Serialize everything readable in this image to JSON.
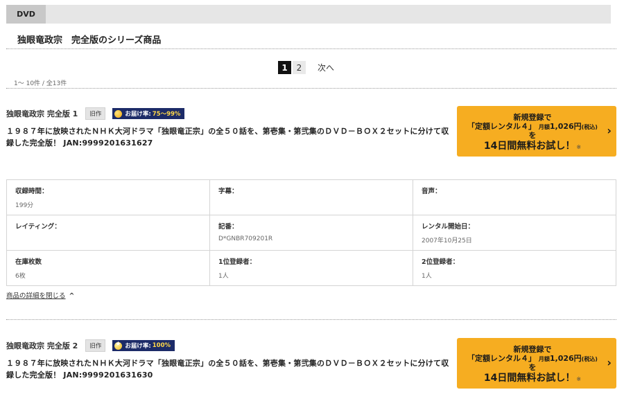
{
  "tab": {
    "label": "DVD"
  },
  "series_title": "独眼竜政宗　完全版のシリーズ商品",
  "pagination": {
    "page1": "1",
    "page2": "2",
    "next": "次へ"
  },
  "result_range": "1～ 10件 / 全13件",
  "products": [
    {
      "name": "独眼竜政宗 完全版 1",
      "old_badge": "旧作",
      "rate_label": "お届け率:",
      "rate_value": "75～99%",
      "description": "１９８７年に放映されたＮＨＫ大河ドラマ「独眼竜正宗」の全５０話を、第壱集・第弐集のＤＶＤ－ＢＯＸ２セットに分けて収録した完全版！ JAN:9999201631627"
    },
    {
      "name": "独眼竜政宗 完全版 2",
      "old_badge": "旧作",
      "rate_label": "お届け率:",
      "rate_value": "100%",
      "description": "１９８７年に放映されたＮＨＫ大河ドラマ「独眼竜正宗」の全５０話を、第壱集・第弐集のＤＶＤ－ＢＯＸ２セットに分けて収録した完全版！ JAN:9999201631630"
    }
  ],
  "cta": {
    "line1": "新規登録で",
    "line2_main": "「定額レンタル４」",
    "line2_small_monthly": "月額",
    "line2_price": "1,026円",
    "line2_small_tax": "(税込)",
    "line3": "を",
    "line4": "14日間無料お試し！",
    "note": "※"
  },
  "spec": {
    "rows": [
      [
        {
          "key": "収録時間：",
          "value": "199分"
        },
        {
          "key": "字幕：",
          "value": ""
        },
        {
          "key": "音声：",
          "value": ""
        }
      ],
      [
        {
          "key": "レイティング：",
          "value": ""
        },
        {
          "key": "記番：",
          "value": "D*GNBR709201R"
        },
        {
          "key": "レンタル開始日：",
          "value": "2007年10月25日"
        }
      ],
      [
        {
          "key": "在庫枚数",
          "value": "6枚"
        },
        {
          "key": "1位登録者：",
          "value": "1人"
        },
        {
          "key": "2位登録者：",
          "value": "1人"
        }
      ]
    ]
  },
  "close_details": "商品の詳細を閉じる"
}
